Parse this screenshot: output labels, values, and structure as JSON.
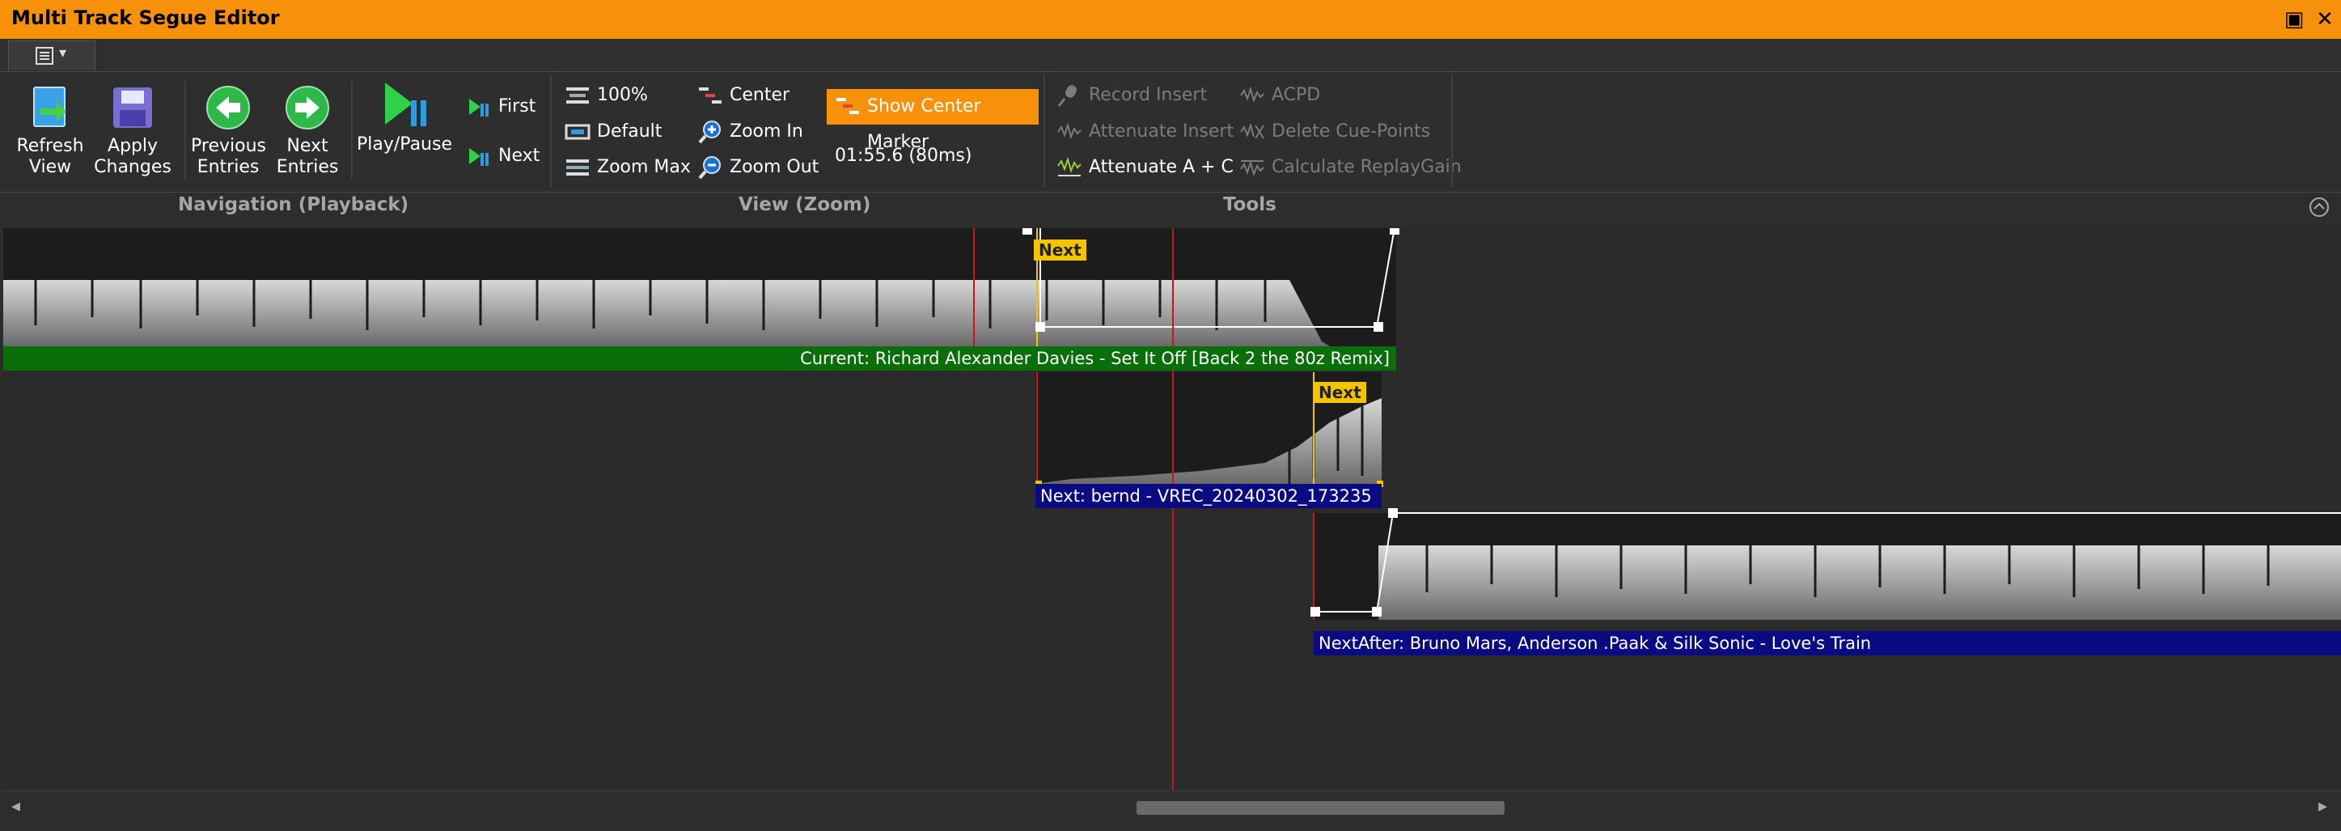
{
  "window": {
    "title": "Multi Track Segue Editor",
    "maximize_glyph": "▣",
    "close_glyph": "✕"
  },
  "menu": {
    "icon": "document-menu-icon",
    "arrow": "▾"
  },
  "ribbon": {
    "navigation": {
      "label": "Navigation (Playback)",
      "refresh_line1": "Refresh",
      "refresh_line2": "View",
      "apply_line1": "Apply",
      "apply_line2": "Changes",
      "prev_line1": "Previous",
      "prev_line2": "Entries",
      "next_line1": "Next",
      "next_line2": "Entries",
      "play_pause": "Play/Pause",
      "first": "First",
      "next": "Next"
    },
    "view": {
      "label": "View (Zoom)",
      "zoom_100": "100%",
      "default": "Default",
      "zoom_max": "Zoom Max",
      "center": "Center",
      "zoom_in": "Zoom In",
      "zoom_out": "Zoom Out",
      "show_center_marker": "Show Center Marker",
      "position": "01:55.6 (80ms)"
    },
    "tools": {
      "label": "Tools",
      "record_insert": "Record Insert",
      "attenuate_insert": "Attenuate Insert",
      "attenuate_ac": "Attenuate A + C",
      "acpd": "ACPD",
      "delete_cue_points": "Delete Cue-Points",
      "calculate_replaygain": "Calculate ReplayGain"
    }
  },
  "tracks": {
    "current": {
      "label": "Current: Richard Alexander Davies - Set It Off [Back 2 the 80z Remix]",
      "color": "#0a6e0a",
      "badge": "Next"
    },
    "next": {
      "label": "Next: bernd - VREC_20240302_173235",
      "color": "#0a0a82",
      "badge": "Next"
    },
    "next_after": {
      "label": "NextAfter: Bruno Mars, Anderson .Paak & Silk Sonic - Love's Train",
      "color": "#0a0a82"
    }
  },
  "colors": {
    "accent": "#f7900a",
    "marker": "#c8161d",
    "background": "#2d2d2d"
  },
  "scroll": {
    "left_arrow": "◂",
    "right_arrow": "▸"
  }
}
